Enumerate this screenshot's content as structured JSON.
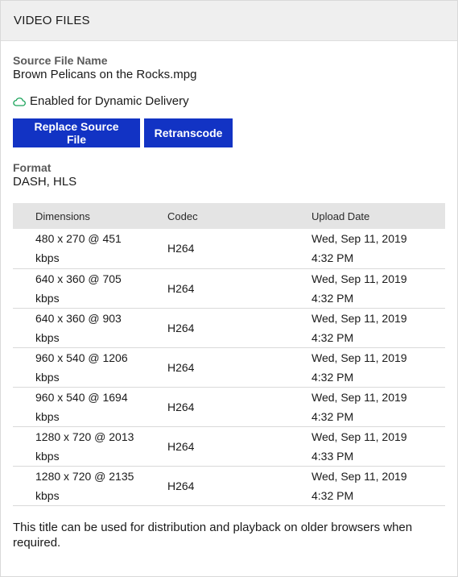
{
  "panel": {
    "title": "VIDEO FILES"
  },
  "source": {
    "label": "Source File Name",
    "filename": "Brown Pelicans on the Rocks.mpg"
  },
  "dynamic_delivery": {
    "icon": "cloud-icon",
    "text": "Enabled for Dynamic Delivery",
    "color": "#1aa35a"
  },
  "buttons": {
    "replace_label": "Replace Source File",
    "retranscode_label": "Retranscode",
    "color": "#1233c4"
  },
  "format": {
    "label": "Format",
    "value": "DASH, HLS"
  },
  "table": {
    "headers": [
      "Dimensions",
      "Codec",
      "Upload Date"
    ],
    "rows": [
      {
        "dim_line1": "480 x 270 @ 451",
        "dim_line2": "kbps",
        "codec": "H264",
        "date_line1": "Wed, Sep 11, 2019",
        "date_line2": "4:32 PM"
      },
      {
        "dim_line1": "640 x 360 @ 705",
        "dim_line2": "kbps",
        "codec": "H264",
        "date_line1": "Wed, Sep 11, 2019",
        "date_line2": "4:32 PM"
      },
      {
        "dim_line1": "640 x 360 @ 903",
        "dim_line2": "kbps",
        "codec": "H264",
        "date_line1": "Wed, Sep 11, 2019",
        "date_line2": "4:32 PM"
      },
      {
        "dim_line1": "960 x 540 @ 1206",
        "dim_line2": "kbps",
        "codec": "H264",
        "date_line1": "Wed, Sep 11, 2019",
        "date_line2": "4:32 PM"
      },
      {
        "dim_line1": "960 x 540 @ 1694",
        "dim_line2": "kbps",
        "codec": "H264",
        "date_line1": "Wed, Sep 11, 2019",
        "date_line2": "4:32 PM"
      },
      {
        "dim_line1": "1280 x 720 @ 2013",
        "dim_line2": "kbps",
        "codec": "H264",
        "date_line1": "Wed, Sep 11, 2019",
        "date_line2": "4:33 PM"
      },
      {
        "dim_line1": "1280 x 720 @ 2135",
        "dim_line2": "kbps",
        "codec": "H264",
        "date_line1": "Wed, Sep 11, 2019",
        "date_line2": "4:32 PM",
        "link": true
      }
    ]
  },
  "footnote": "This title can be used for distribution and playback on older browsers when required."
}
